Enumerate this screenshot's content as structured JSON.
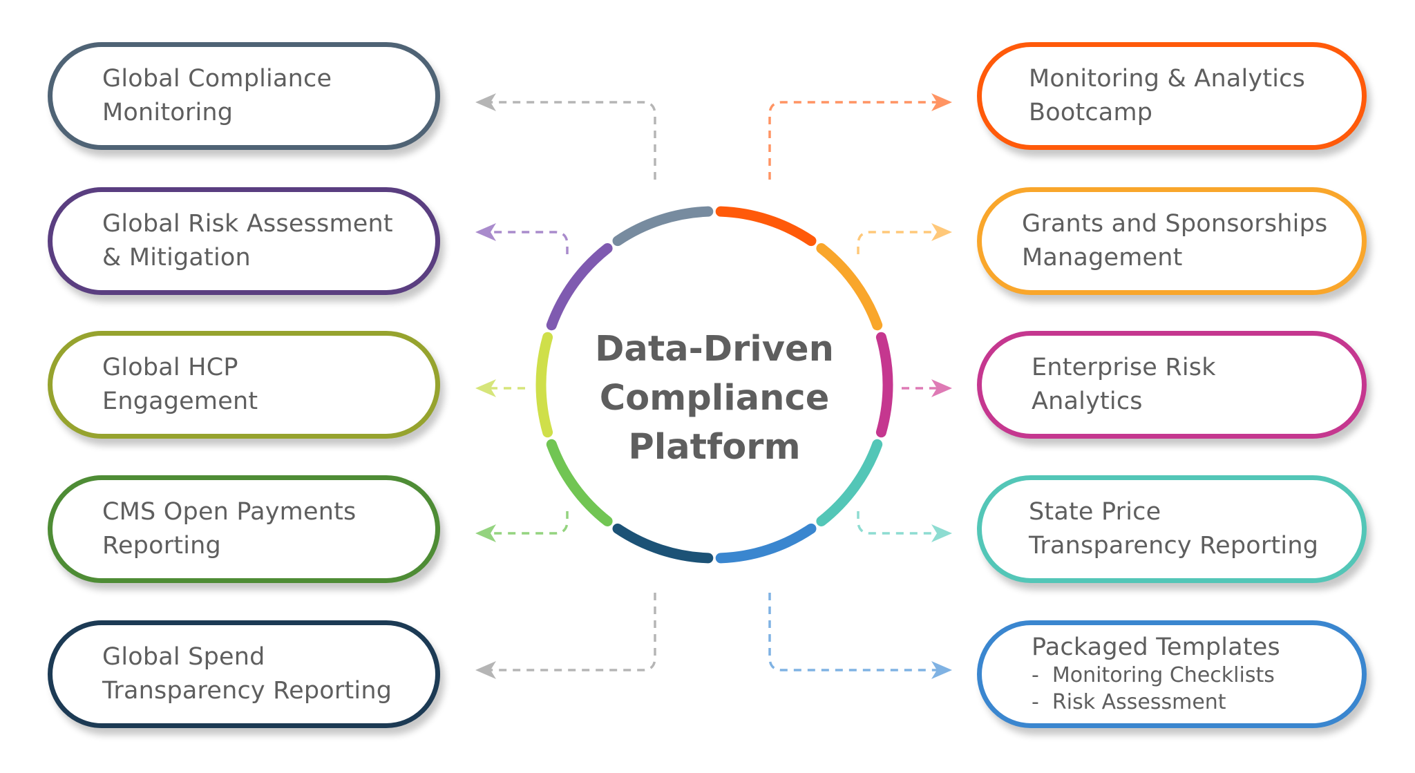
{
  "center": {
    "title_lines": [
      "Data-Driven",
      "Compliance",
      "Platform"
    ]
  },
  "left_items": [
    {
      "lines": [
        "Global Compliance",
        "Monitoring"
      ],
      "color": "#4f6375",
      "connector_color": "#b5b5b5"
    },
    {
      "lines": [
        "Global Risk Assessment",
        "& Mitigation"
      ],
      "color": "#5a3e80",
      "connector_color": "#a98bcc"
    },
    {
      "lines": [
        "Global HCP",
        "Engagement"
      ],
      "color": "#96a32e",
      "connector_color": "#d6e57a"
    },
    {
      "lines": [
        "CMS Open Payments",
        "Reporting"
      ],
      "color": "#4e8c35",
      "connector_color": "#94d37f"
    },
    {
      "lines": [
        "Global Spend",
        "Transparency Reporting"
      ],
      "color": "#1c3a54",
      "connector_color": "#b5b5b5"
    }
  ],
  "right_items": [
    {
      "lines": [
        "Monitoring & Analytics",
        "Bootcamp"
      ],
      "sub": [],
      "color": "#ff5a0a",
      "connector_color": "#ff9463"
    },
    {
      "lines": [
        "Grants and Sponsorships",
        "Management"
      ],
      "sub": [],
      "color": "#f9a62b",
      "connector_color": "#ffc879"
    },
    {
      "lines": [
        "Enterprise Risk",
        "Analytics"
      ],
      "sub": [],
      "color": "#c5378f",
      "connector_color": "#de7ab5"
    },
    {
      "lines": [
        "State Price",
        "Transparency Reporting"
      ],
      "sub": [],
      "color": "#53c6b7",
      "connector_color": "#8ddcd1"
    },
    {
      "lines": [
        "Packaged Templates"
      ],
      "sub": [
        "-  Monitoring Checklists",
        "-  Risk Assessment"
      ],
      "color": "#3a86cf",
      "connector_color": "#7fb2e3"
    }
  ],
  "ring_segments": [
    {
      "name": "slate",
      "color": "#778b9f"
    },
    {
      "name": "orange",
      "color": "#ff5a0a"
    },
    {
      "name": "amber",
      "color": "#f9a62b"
    },
    {
      "name": "magenta",
      "color": "#c5378f"
    },
    {
      "name": "teal",
      "color": "#53c6b7"
    },
    {
      "name": "blue",
      "color": "#3a86cf"
    },
    {
      "name": "navy",
      "color": "#1c5276"
    },
    {
      "name": "green",
      "color": "#71c553"
    },
    {
      "name": "lime",
      "color": "#cfdf4a"
    },
    {
      "name": "purple",
      "color": "#7f5ab0"
    }
  ]
}
